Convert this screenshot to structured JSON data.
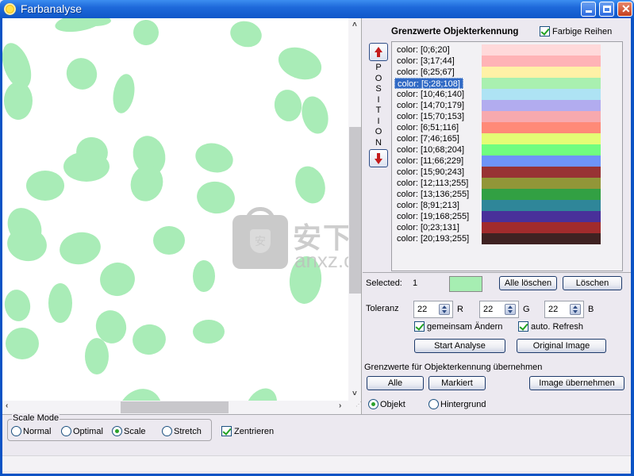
{
  "window": {
    "title": "Farbanalyse",
    "icon": "sun-app-icon",
    "controls": {
      "minimize": "minimize",
      "maximize": "maximize",
      "close": "close"
    }
  },
  "viewer": {
    "description": "segmented cell image, objects highlighted in light green",
    "highlight_color": "#a9ecb7",
    "watermark": {
      "cn": "安下载",
      "en": "anxz.com",
      "shield": "安"
    }
  },
  "panel": {
    "group_title": "Grenzwerte Objekterkennung",
    "colored_rows": {
      "label": "Farbige Reihen",
      "checked": true
    },
    "position_label": [
      "P",
      "O",
      "S",
      "I",
      "T",
      "I",
      "O",
      "N"
    ],
    "list": [
      {
        "label": "color:  [0;6;20]",
        "swatch": "#ffd9da"
      },
      {
        "label": "color:  [3;17;44]",
        "swatch": "#ffb3b6"
      },
      {
        "label": "color:  [6;25;67]",
        "swatch": "#fff1a6"
      },
      {
        "label": "color:  [5;28;108]",
        "swatch": "#a9f0b0",
        "selected": true
      },
      {
        "label": "color:  [10;46;140]",
        "swatch": "#aee3f4"
      },
      {
        "label": "color:  [14;70;179]",
        "swatch": "#b2acef"
      },
      {
        "label": "color:  [15;70;153]",
        "swatch": "#f7a9ae"
      },
      {
        "label": "color:  [6;51;116]",
        "swatch": "#ff8a78"
      },
      {
        "label": "color:  [7;46;165]",
        "swatch": "#e4fd75"
      },
      {
        "label": "color:  [10;68;204]",
        "swatch": "#70fd80"
      },
      {
        "label": "color:  [11;66;229]",
        "swatch": "#6e94f8"
      },
      {
        "label": "color:  [15;90;243]",
        "swatch": "#983334"
      },
      {
        "label": "color:  [12;113;255]",
        "swatch": "#929638"
      },
      {
        "label": "color:  [13;136;255]",
        "swatch": "#32a043"
      },
      {
        "label": "color:  [8;91;213]",
        "swatch": "#2f8699"
      },
      {
        "label": "color:  [19;168;255]",
        "swatch": "#49309a"
      },
      {
        "label": "color:  [0;23;131]",
        "swatch": "#a12b2c"
      },
      {
        "label": "color:  [20;193;255]",
        "swatch": "#3f2222"
      }
    ],
    "selected": {
      "label": "Selected:",
      "value": "1",
      "color": "#a6eeb2"
    },
    "buttons": {
      "clear_all": "Alle löschen",
      "delete": "Löschen",
      "start_analysis": "Start Analyse",
      "original_image": "Original Image",
      "all": "Alle",
      "marked": "Markiert",
      "apply_image": "Image übernehmen"
    },
    "tolerance": {
      "label": "Toleranz",
      "r": {
        "value": "22",
        "label": "R"
      },
      "g": {
        "value": "22",
        "label": "G"
      },
      "b": {
        "value": "22",
        "label": "B"
      }
    },
    "change_together": {
      "label": "gemeinsam Ändern",
      "checked": true
    },
    "auto_refresh": {
      "label": "auto. Refresh",
      "checked": true
    },
    "apply_title": "Grenzwerte für Objekterkennung übernehmen",
    "target": {
      "options": [
        {
          "label": "Objekt",
          "checked": true
        },
        {
          "label": "Hintergrund",
          "checked": false
        }
      ]
    }
  },
  "scale_mode": {
    "legend": "Scale Mode",
    "options": [
      {
        "label": "Normal",
        "checked": false
      },
      {
        "label": "Optimal",
        "checked": false
      },
      {
        "label": "Scale",
        "checked": true
      },
      {
        "label": "Stretch",
        "checked": false
      }
    ],
    "center": {
      "label": "Zentrieren",
      "checked": true
    }
  }
}
